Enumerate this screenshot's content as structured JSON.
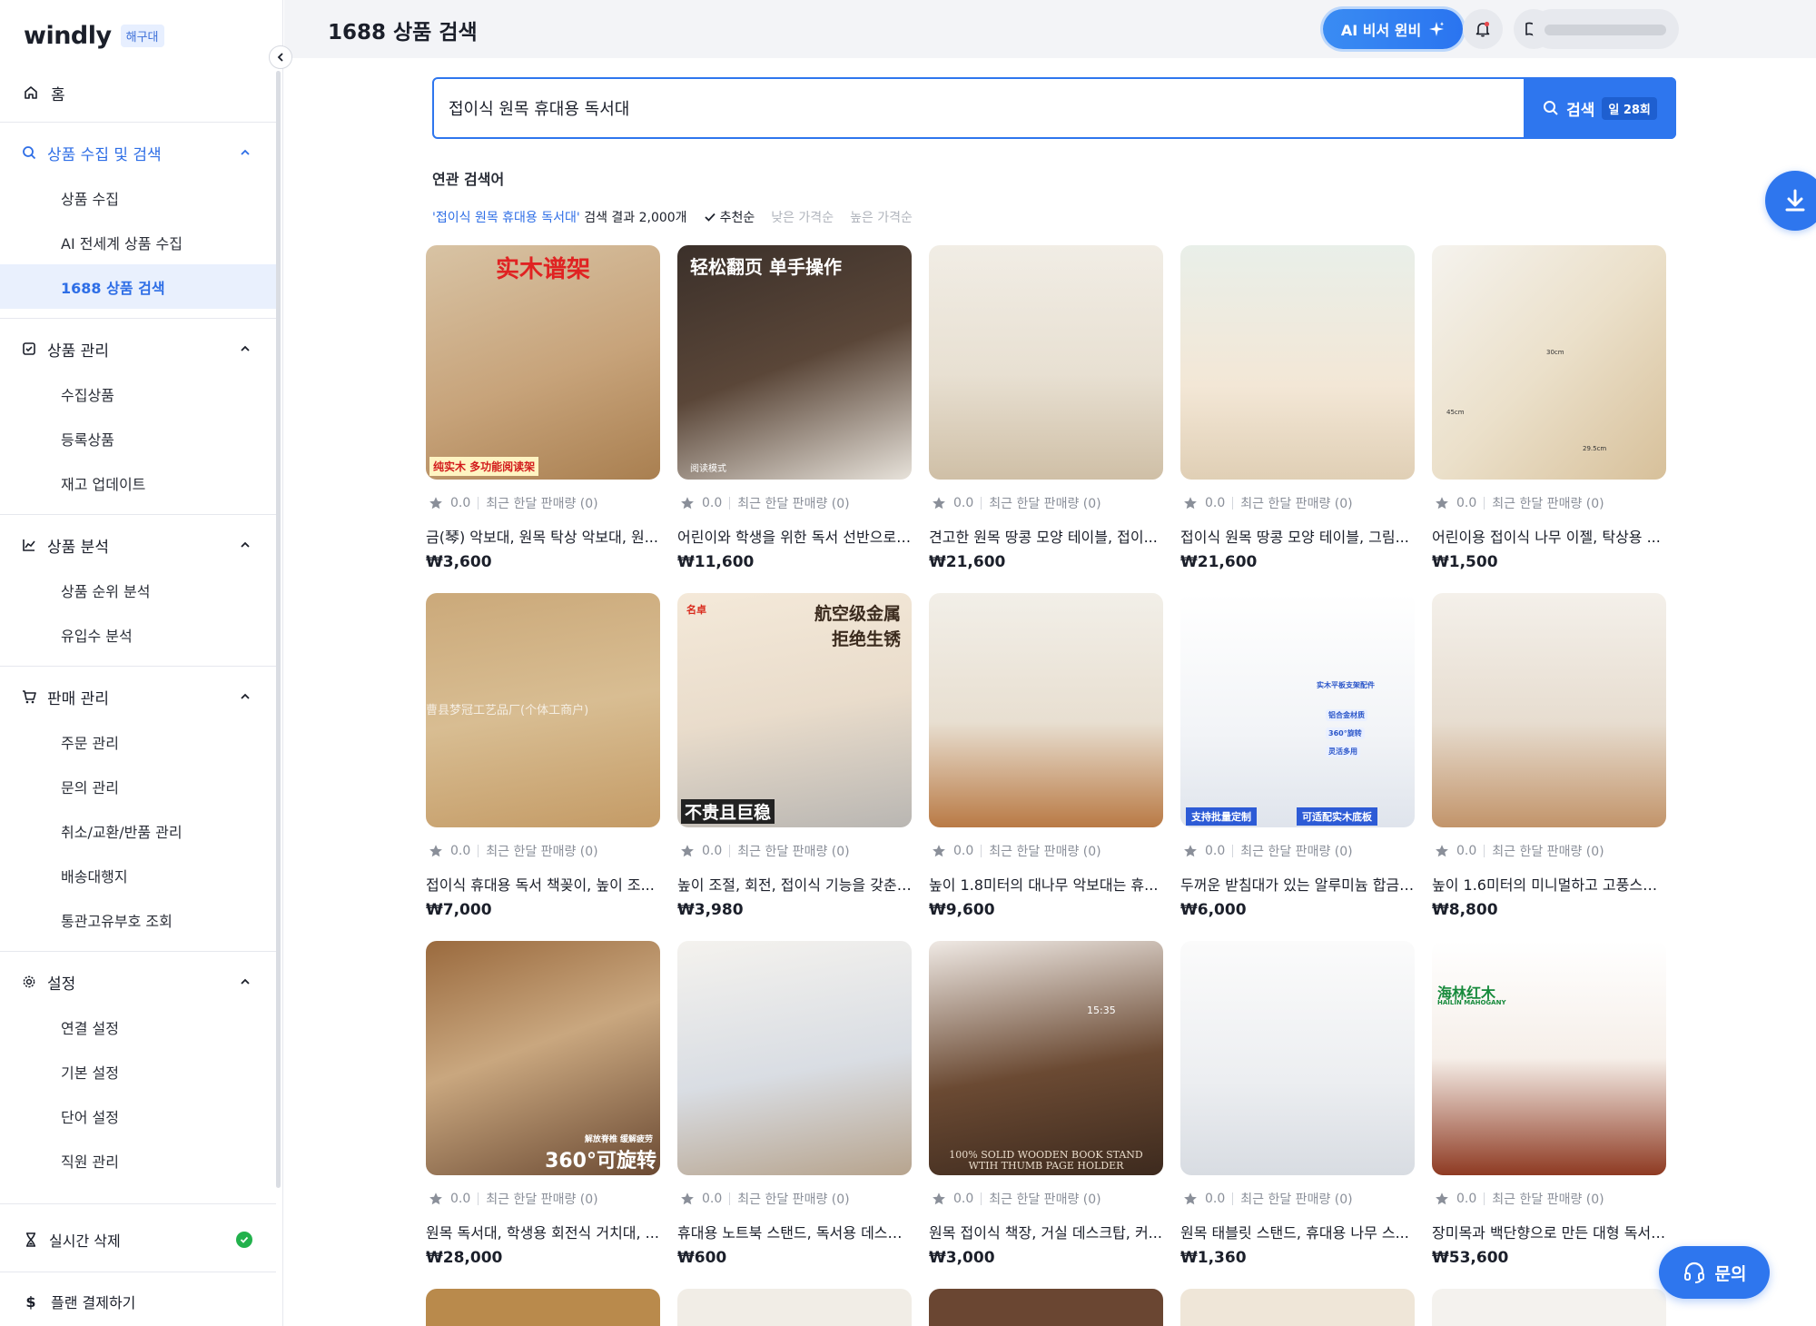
{
  "app": {
    "logo": "windly",
    "badge": "해구대"
  },
  "sidebar": {
    "home": "홈",
    "groups": [
      {
        "label": "상품 수집 및 검색",
        "active": true,
        "items": [
          "상품 수집",
          "AI 전세계 상품 수집",
          "1688 상품 검색"
        ],
        "selected": 2
      },
      {
        "label": "상품 관리",
        "items": [
          "수집상품",
          "등록상품",
          "재고 업데이트"
        ]
      },
      {
        "label": "상품 분석",
        "items": [
          "상품 순위 분석",
          "유입수 분석"
        ]
      },
      {
        "label": "판매 관리",
        "items": [
          "주문 관리",
          "문의 관리",
          "취소/교환/반품 관리",
          "배송대행지",
          "통관고유부호 조회"
        ]
      },
      {
        "label": "설정",
        "items": [
          "연결 설정",
          "기본 설정",
          "단어 설정",
          "직원 관리"
        ]
      }
    ],
    "realtime_delete": "실시간 삭제",
    "plan_payment": "플랜 결제하기"
  },
  "header": {
    "title": "1688 상품 검색",
    "ai_button": "AI 비서 윈비"
  },
  "search": {
    "query": "접이식 원목 휴대용 독서대",
    "button": "검색",
    "quota": "일 28회"
  },
  "related_label": "연관 검색어",
  "results": {
    "query_text": "'접이식 원목 휴대용 독서대'",
    "count_text": "검색 결과 2,000개",
    "sorts": [
      "추천순",
      "낮은 가격순",
      "높은 가격순"
    ]
  },
  "products": [
    {
      "rating": "0.0",
      "sales": "최근 한달 판매량 (0)",
      "title": "금(琴) 악보대, 원목 탁상 악보대, 원...",
      "price": "₩3,600",
      "img_text": [
        "实木谱架",
        "纯实木 多功能阅读架"
      ]
    },
    {
      "rating": "0.0",
      "sales": "최근 한달 판매량 (0)",
      "title": "어린이와 학생을 위한 독서 선반으로,...",
      "price": "₩11,600",
      "img_text": [
        "轻松翻页 单手操作",
        "阅读模式"
      ]
    },
    {
      "rating": "0.0",
      "sales": "최근 한달 판매량 (0)",
      "title": "견고한 원목 땅콩 모양 테이블, 접이...",
      "price": "₩21,600",
      "img_text": []
    },
    {
      "rating": "0.0",
      "sales": "최근 한달 판매량 (0)",
      "title": "접이식 원목 땅콩 모양 테이블, 그림...",
      "price": "₩21,600",
      "img_text": []
    },
    {
      "rating": "0.0",
      "sales": "최근 한달 판매량 (0)",
      "title": "어린이용 접이식 나무 이젤, 탁상용 ...",
      "price": "₩1,500",
      "img_text": [
        "30cm",
        "45cm",
        "29.5cm"
      ]
    },
    {
      "rating": "0.0",
      "sales": "최근 한달 판매량 (0)",
      "title": "접이식 휴대용 독서 책꽂이, 높이 조...",
      "price": "₩7,000",
      "img_text": [
        "曹县梦冠工艺品厂(个体工商户)"
      ]
    },
    {
      "rating": "0.0",
      "sales": "최근 한달 판매량 (0)",
      "title": "높이 조절, 회전, 접이식 기능을 갖춘 ...",
      "price": "₩3,980",
      "img_text": [
        "航空级金属",
        "拒绝生锈",
        "不贵且巨稳",
        "名卓"
      ]
    },
    {
      "rating": "0.0",
      "sales": "최근 한달 판매량 (0)",
      "title": "높이 1.8미터의 대나무 악보대는 휴...",
      "price": "₩9,600",
      "img_text": []
    },
    {
      "rating": "0.0",
      "sales": "최근 한달 판매량 (0)",
      "title": "두꺼운 받침대가 있는 알루미늄 합금 ...",
      "price": "₩6,000",
      "img_text": [
        "支持批量定制",
        "可适配实木底板",
        "实木平板支架配件",
        "铝合金材质",
        "360°旋转",
        "灵活多用"
      ]
    },
    {
      "rating": "0.0",
      "sales": "최근 한달 판매량 (0)",
      "title": "높이 1.6미터의 미니멀하고 고풍스러...",
      "price": "₩8,800",
      "img_text": []
    },
    {
      "rating": "0.0",
      "sales": "최근 한달 판매량 (0)",
      "title": "원목 독서대, 학생용 회전식 거치대, ...",
      "price": "₩28,000",
      "img_text": [
        "360°可旋转",
        "解放脊椎 缓解疲劳"
      ]
    },
    {
      "rating": "0.0",
      "sales": "최근 한달 판매량 (0)",
      "title": "휴대용 노트북 스탠드, 독서용 데스크...",
      "price": "₩600",
      "img_text": []
    },
    {
      "rating": "0.0",
      "sales": "최근 한달 판매량 (0)",
      "title": "원목 접이식 책장, 거실 데스크탑, 커...",
      "price": "₩3,000",
      "img_text": [
        "100% SOLID WOODEN BOOK STAND",
        "WTIH THUMB PAGE HOLDER",
        "15:35"
      ]
    },
    {
      "rating": "0.0",
      "sales": "최근 한달 판매량 (0)",
      "title": "원목 태블릿 스탠드, 휴대용 나무 스...",
      "price": "₩1,360",
      "img_text": []
    },
    {
      "rating": "0.0",
      "sales": "최근 한달 판매량 (0)",
      "title": "장미목과 백단향으로 만든 대형 독서 ...",
      "price": "₩53,600",
      "img_text": [
        "海林红木",
        "HAILIN MAHOGANY"
      ]
    }
  ],
  "chat_button": "문의",
  "colors": {
    "accent": "#2e76ee",
    "selected_bg": "#e9f0fd",
    "success": "#22b14c"
  }
}
